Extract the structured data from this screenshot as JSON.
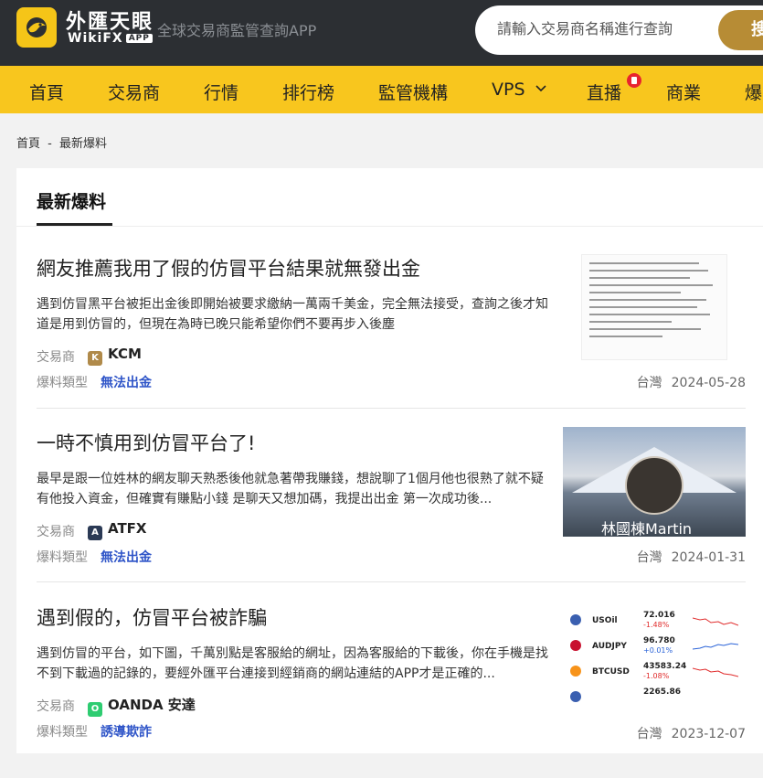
{
  "header": {
    "brand_cn": "外匯天眼",
    "brand_en": "WikiFX",
    "brand_app": "APP",
    "tagline": "全球交易商監管查詢APP",
    "search_placeholder": "請輸入交易商名稱進行查詢",
    "search_button": "搜"
  },
  "nav": {
    "items": [
      "首頁",
      "交易商",
      "行情",
      "排行榜",
      "監管機構",
      "VPS",
      "直播",
      "商業",
      "爆"
    ]
  },
  "breadcrumb": {
    "home": "首頁",
    "separator": "-",
    "current": "最新爆料"
  },
  "section": {
    "title": "最新爆料"
  },
  "labels": {
    "broker": "交易商",
    "type": "爆料類型"
  },
  "posts": [
    {
      "title": "網友推薦我用了假的仿冒平台結果就無發出金",
      "desc": "遇到仿冒黑平台被拒出金後即開始被要求繳納一萬兩千美金，完全無法接受，查詢之後才知道是用到仿冒的，但現在為時已晚只能希望你們不要再步入後塵",
      "broker": "KCM",
      "broker_color": "#b08a4a",
      "type": "無法出金",
      "location": "台灣",
      "date": "2024-05-28"
    },
    {
      "title": "一時不慎用到仿冒平台了!",
      "desc": "最早是跟一位姓林的網友聊天熟悉後他就急著帶我賺錢，想說聊了1個月他也很熟了就不疑有他投入資金，但確實有賺點小錢 是聊天又想加碼，我提出出金 第一次成功後...",
      "broker": "ATFX",
      "broker_color": "#2b3a55",
      "type": "無法出金",
      "location": "台灣",
      "date": "2024-01-31",
      "thumb_text": "林國棟Martin"
    },
    {
      "title": "遇到假的，仿冒平台被詐騙",
      "desc": "遇到仿冒的平台，如下圖，千萬別點是客服給的網址，因為客服給的下載後，你在手機是找不到下載過的記錄的，要經外匯平台連接到經銷商的網站連結的APP才是正確的...",
      "broker": "OANDA 安達",
      "broker_color": "#2ecc71",
      "type": "誘導欺詐",
      "location": "台灣",
      "date": "2023-12-07",
      "quotes": [
        {
          "symbol": "USOil",
          "value": "72.016",
          "change": "-1.48%",
          "color": "#e02b2b",
          "flag": "#3a5fb0"
        },
        {
          "symbol": "AUDJPY",
          "value": "96.780",
          "change": "+0.01%",
          "color": "#2a63d8",
          "flag": "#c8102e"
        },
        {
          "symbol": "BTCUSD",
          "value": "43583.24",
          "change": "-1.08%",
          "color": "#e02b2b",
          "flag": "#f7931a"
        },
        {
          "symbol": "",
          "value": "2265.86",
          "change": "",
          "color": "#e02b2b",
          "flag": "#3a5fb0"
        }
      ]
    }
  ]
}
